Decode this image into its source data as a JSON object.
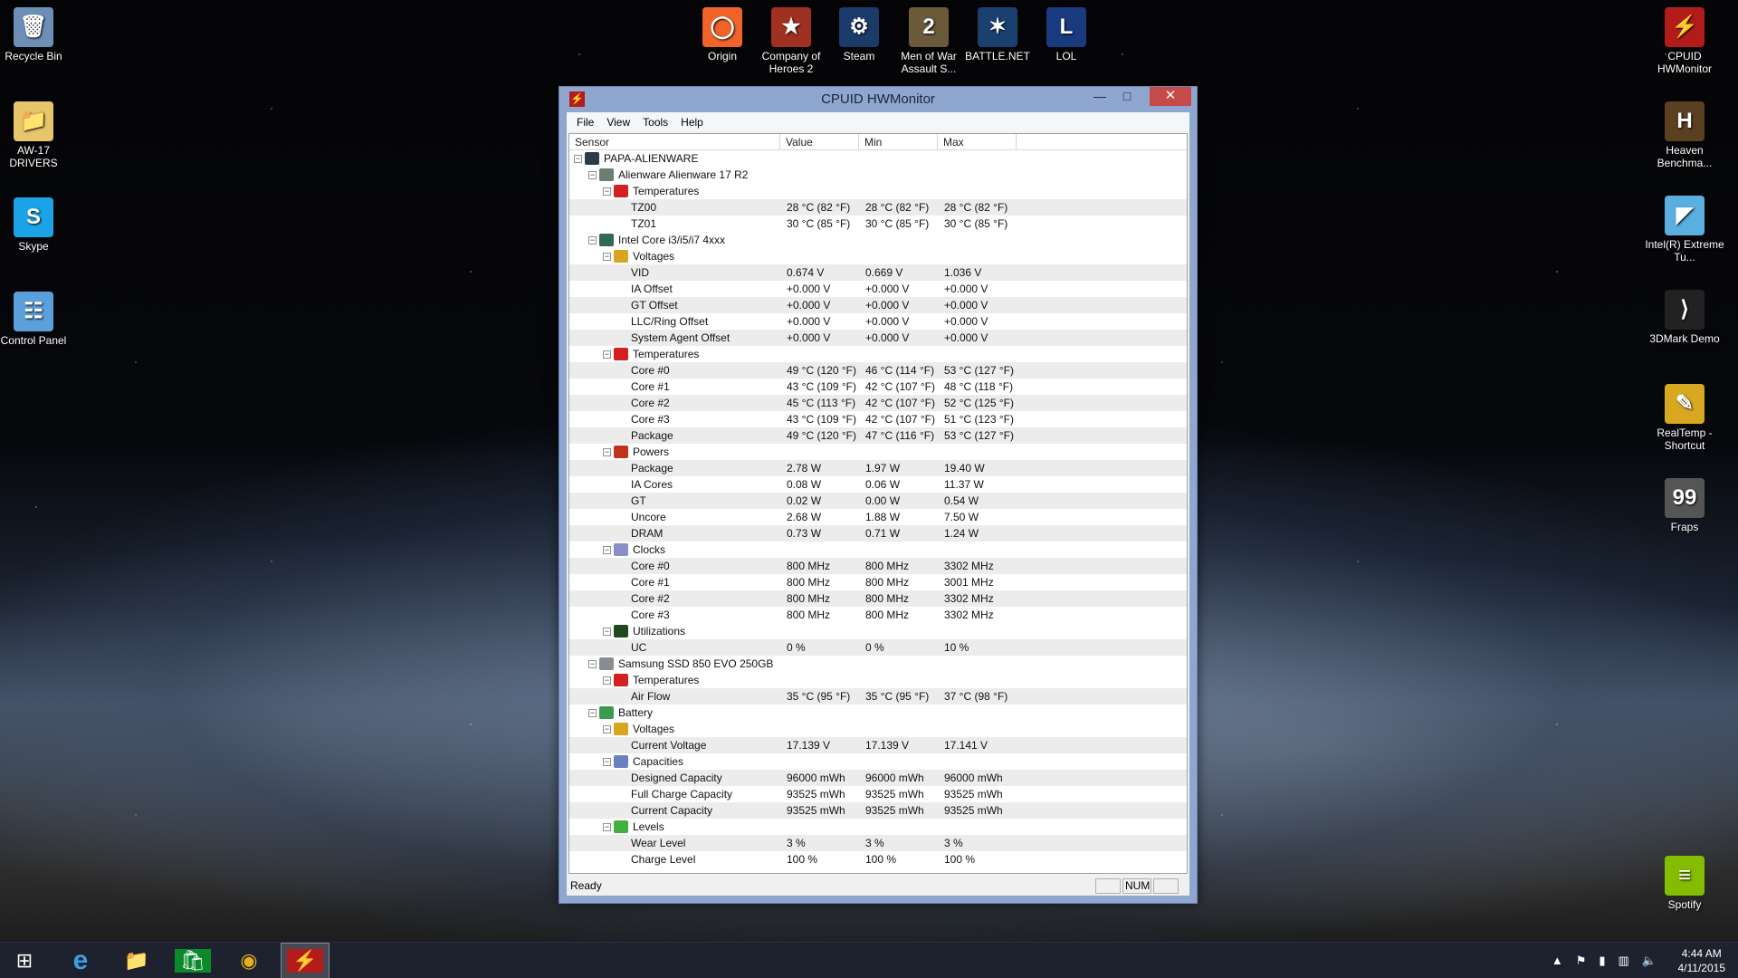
{
  "desktop": {
    "left_icons": [
      {
        "label": "Recycle Bin",
        "icon": "recycle-bin-icon"
      },
      {
        "label": "AW-17 DRIVERS",
        "icon": "folder-icon"
      },
      {
        "label": "Skype",
        "icon": "skype-icon"
      },
      {
        "label": "Control Panel",
        "icon": "control-panel-icon"
      }
    ],
    "top_icons": [
      {
        "label": "Origin",
        "icon": "origin-icon"
      },
      {
        "label": "Company of Heroes 2",
        "icon": "company-of-heroes-icon"
      },
      {
        "label": "Steam",
        "icon": "steam-icon"
      },
      {
        "label": "Men of War Assault S...",
        "icon": "men-of-war-icon"
      },
      {
        "label": "BATTLE.NET",
        "icon": "battlenet-icon"
      },
      {
        "label": "LOL",
        "icon": "lol-icon"
      }
    ],
    "right_icons": [
      {
        "label": "CPUID HWMonitor",
        "icon": "hwmonitor-icon"
      },
      {
        "label": "Heaven Benchma...",
        "icon": "heaven-icon"
      },
      {
        "label": "Intel(R) Extreme Tu...",
        "icon": "intel-xtu-icon"
      },
      {
        "label": "3DMark Demo",
        "icon": "3dmark-icon"
      },
      {
        "label": "RealTemp - Shortcut",
        "icon": "realtemp-icon"
      },
      {
        "label": "Fraps",
        "icon": "fraps-icon"
      },
      {
        "label": "Spotify",
        "icon": "spotify-icon"
      }
    ]
  },
  "window": {
    "title": "CPUID HWMonitor",
    "menu": [
      "File",
      "View",
      "Tools",
      "Help"
    ],
    "columns": [
      "Sensor",
      "Value",
      "Min",
      "Max"
    ],
    "rows": [
      {
        "level": 0,
        "label": "PAPA-ALIENWARE",
        "icon": "computer-icon"
      },
      {
        "level": 1,
        "label": "Alienware Alienware 17 R2",
        "icon": "motherboard-icon"
      },
      {
        "level": 2,
        "label": "Temperatures",
        "icon": "thermometer-icon"
      },
      {
        "level": 3,
        "label": "TZ00",
        "value": "28 °C  (82 °F)",
        "min": "28 °C  (82 °F)",
        "max": "28 °C  (82 °F)"
      },
      {
        "level": 3,
        "label": "TZ01",
        "value": "30 °C  (85 °F)",
        "min": "30 °C  (85 °F)",
        "max": "30 °C  (85 °F)"
      },
      {
        "level": 1,
        "label": "Intel Core i3/i5/i7 4xxx",
        "icon": "cpu-icon"
      },
      {
        "level": 2,
        "label": "Voltages",
        "icon": "voltage-icon"
      },
      {
        "level": 3,
        "label": "VID",
        "value": "0.674 V",
        "min": "0.669 V",
        "max": "1.036 V"
      },
      {
        "level": 3,
        "label": "IA Offset",
        "value": "+0.000 V",
        "min": "+0.000 V",
        "max": "+0.000 V"
      },
      {
        "level": 3,
        "label": "GT Offset",
        "value": "+0.000 V",
        "min": "+0.000 V",
        "max": "+0.000 V"
      },
      {
        "level": 3,
        "label": "LLC/Ring Offset",
        "value": "+0.000 V",
        "min": "+0.000 V",
        "max": "+0.000 V"
      },
      {
        "level": 3,
        "label": "System Agent Offset",
        "value": "+0.000 V",
        "min": "+0.000 V",
        "max": "+0.000 V"
      },
      {
        "level": 2,
        "label": "Temperatures",
        "icon": "thermometer-icon"
      },
      {
        "level": 3,
        "label": "Core #0",
        "value": "49 °C  (120 °F)",
        "min": "46 °C  (114 °F)",
        "max": "53 °C  (127 °F)"
      },
      {
        "level": 3,
        "label": "Core #1",
        "value": "43 °C  (109 °F)",
        "min": "42 °C  (107 °F)",
        "max": "48 °C  (118 °F)"
      },
      {
        "level": 3,
        "label": "Core #2",
        "value": "45 °C  (113 °F)",
        "min": "42 °C  (107 °F)",
        "max": "52 °C  (125 °F)"
      },
      {
        "level": 3,
        "label": "Core #3",
        "value": "43 °C  (109 °F)",
        "min": "42 °C  (107 °F)",
        "max": "51 °C  (123 °F)"
      },
      {
        "level": 3,
        "label": "Package",
        "value": "49 °C  (120 °F)",
        "min": "47 °C  (116 °F)",
        "max": "53 °C  (127 °F)"
      },
      {
        "level": 2,
        "label": "Powers",
        "icon": "power-icon"
      },
      {
        "level": 3,
        "label": "Package",
        "value": "2.78 W",
        "min": "1.97 W",
        "max": "19.40 W"
      },
      {
        "level": 3,
        "label": "IA Cores",
        "value": "0.08 W",
        "min": "0.06 W",
        "max": "11.37 W"
      },
      {
        "level": 3,
        "label": "GT",
        "value": "0.02 W",
        "min": "0.00 W",
        "max": "0.54 W"
      },
      {
        "level": 3,
        "label": "Uncore",
        "value": "2.68 W",
        "min": "1.88 W",
        "max": "7.50 W"
      },
      {
        "level": 3,
        "label": "DRAM",
        "value": "0.73 W",
        "min": "0.71 W",
        "max": "1.24 W"
      },
      {
        "level": 2,
        "label": "Clocks",
        "icon": "clock-icon"
      },
      {
        "level": 3,
        "label": "Core #0",
        "value": "800 MHz",
        "min": "800 MHz",
        "max": "3302 MHz"
      },
      {
        "level": 3,
        "label": "Core #1",
        "value": "800 MHz",
        "min": "800 MHz",
        "max": "3001 MHz"
      },
      {
        "level": 3,
        "label": "Core #2",
        "value": "800 MHz",
        "min": "800 MHz",
        "max": "3302 MHz"
      },
      {
        "level": 3,
        "label": "Core #3",
        "value": "800 MHz",
        "min": "800 MHz",
        "max": "3302 MHz"
      },
      {
        "level": 2,
        "label": "Utilizations",
        "icon": "utilization-icon"
      },
      {
        "level": 3,
        "label": "UC",
        "value": "0 %",
        "min": "0 %",
        "max": "10 %"
      },
      {
        "level": 1,
        "label": "Samsung SSD 850 EVO 250GB",
        "icon": "disk-icon"
      },
      {
        "level": 2,
        "label": "Temperatures",
        "icon": "thermometer-icon"
      },
      {
        "level": 3,
        "label": "Air Flow",
        "value": "35 °C  (95 °F)",
        "min": "35 °C  (95 °F)",
        "max": "37 °C  (98 °F)"
      },
      {
        "level": 1,
        "label": "Battery",
        "icon": "battery-icon"
      },
      {
        "level": 2,
        "label": "Voltages",
        "icon": "voltage-icon"
      },
      {
        "level": 3,
        "label": "Current Voltage",
        "value": "17.139 V",
        "min": "17.139 V",
        "max": "17.141 V"
      },
      {
        "level": 2,
        "label": "Capacities",
        "icon": "capacity-icon"
      },
      {
        "level": 3,
        "label": "Designed Capacity",
        "value": "96000 mWh",
        "min": "96000 mWh",
        "max": "96000 mWh"
      },
      {
        "level": 3,
        "label": "Full Charge Capacity",
        "value": "93525 mWh",
        "min": "93525 mWh",
        "max": "93525 mWh"
      },
      {
        "level": 3,
        "label": "Current Capacity",
        "value": "93525 mWh",
        "min": "93525 mWh",
        "max": "93525 mWh"
      },
      {
        "level": 2,
        "label": "Levels",
        "icon": "levels-icon"
      },
      {
        "level": 3,
        "label": "Wear Level",
        "value": "3 %",
        "min": "3 %",
        "max": "3 %"
      },
      {
        "level": 3,
        "label": "Charge Level",
        "value": "100 %",
        "min": "100 %",
        "max": "100 %"
      }
    ],
    "status": {
      "text": "Ready",
      "num": "NUM"
    }
  },
  "taskbar": {
    "apps": [
      "start-icon",
      "internet-explorer-icon",
      "file-explorer-icon",
      "store-icon",
      "chrome-icon",
      "hwmonitor-icon"
    ],
    "time": "4:44 AM",
    "date": "4/11/2015"
  },
  "colors": {
    "icon": {
      "computer-icon": "#2d3a4a",
      "motherboard-icon": "#6c7d70",
      "thermometer-icon": "#d42020",
      "cpu-icon": "#2f6a55",
      "voltage-icon": "#d9a520",
      "power-icon": "#c23020",
      "clock-icon": "#8a8ec8",
      "utilization-icon": "#1f4a1f",
      "disk-icon": "#888c90",
      "battery-icon": "#3a9a50",
      "capacity-icon": "#6a80c0",
      "levels-icon": "#40b040"
    }
  }
}
